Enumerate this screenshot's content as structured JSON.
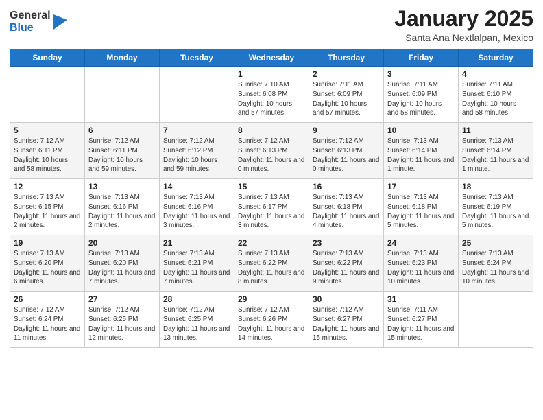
{
  "logo": {
    "general": "General",
    "blue": "Blue"
  },
  "header": {
    "month": "January 2025",
    "location": "Santa Ana Nextlalpan, Mexico"
  },
  "days_of_week": [
    "Sunday",
    "Monday",
    "Tuesday",
    "Wednesday",
    "Thursday",
    "Friday",
    "Saturday"
  ],
  "weeks": [
    [
      {
        "day": "",
        "info": ""
      },
      {
        "day": "",
        "info": ""
      },
      {
        "day": "",
        "info": ""
      },
      {
        "day": "1",
        "info": "Sunrise: 7:10 AM\nSunset: 6:08 PM\nDaylight: 10 hours and 57 minutes."
      },
      {
        "day": "2",
        "info": "Sunrise: 7:11 AM\nSunset: 6:09 PM\nDaylight: 10 hours and 57 minutes."
      },
      {
        "day": "3",
        "info": "Sunrise: 7:11 AM\nSunset: 6:09 PM\nDaylight: 10 hours and 58 minutes."
      },
      {
        "day": "4",
        "info": "Sunrise: 7:11 AM\nSunset: 6:10 PM\nDaylight: 10 hours and 58 minutes."
      }
    ],
    [
      {
        "day": "5",
        "info": "Sunrise: 7:12 AM\nSunset: 6:11 PM\nDaylight: 10 hours and 58 minutes."
      },
      {
        "day": "6",
        "info": "Sunrise: 7:12 AM\nSunset: 6:11 PM\nDaylight: 10 hours and 59 minutes."
      },
      {
        "day": "7",
        "info": "Sunrise: 7:12 AM\nSunset: 6:12 PM\nDaylight: 10 hours and 59 minutes."
      },
      {
        "day": "8",
        "info": "Sunrise: 7:12 AM\nSunset: 6:13 PM\nDaylight: 11 hours and 0 minutes."
      },
      {
        "day": "9",
        "info": "Sunrise: 7:12 AM\nSunset: 6:13 PM\nDaylight: 11 hours and 0 minutes."
      },
      {
        "day": "10",
        "info": "Sunrise: 7:13 AM\nSunset: 6:14 PM\nDaylight: 11 hours and 1 minute."
      },
      {
        "day": "11",
        "info": "Sunrise: 7:13 AM\nSunset: 6:14 PM\nDaylight: 11 hours and 1 minute."
      }
    ],
    [
      {
        "day": "12",
        "info": "Sunrise: 7:13 AM\nSunset: 6:15 PM\nDaylight: 11 hours and 2 minutes."
      },
      {
        "day": "13",
        "info": "Sunrise: 7:13 AM\nSunset: 6:16 PM\nDaylight: 11 hours and 2 minutes."
      },
      {
        "day": "14",
        "info": "Sunrise: 7:13 AM\nSunset: 6:16 PM\nDaylight: 11 hours and 3 minutes."
      },
      {
        "day": "15",
        "info": "Sunrise: 7:13 AM\nSunset: 6:17 PM\nDaylight: 11 hours and 3 minutes."
      },
      {
        "day": "16",
        "info": "Sunrise: 7:13 AM\nSunset: 6:18 PM\nDaylight: 11 hours and 4 minutes."
      },
      {
        "day": "17",
        "info": "Sunrise: 7:13 AM\nSunset: 6:18 PM\nDaylight: 11 hours and 5 minutes."
      },
      {
        "day": "18",
        "info": "Sunrise: 7:13 AM\nSunset: 6:19 PM\nDaylight: 11 hours and 5 minutes."
      }
    ],
    [
      {
        "day": "19",
        "info": "Sunrise: 7:13 AM\nSunset: 6:20 PM\nDaylight: 11 hours and 6 minutes."
      },
      {
        "day": "20",
        "info": "Sunrise: 7:13 AM\nSunset: 6:20 PM\nDaylight: 11 hours and 7 minutes."
      },
      {
        "day": "21",
        "info": "Sunrise: 7:13 AM\nSunset: 6:21 PM\nDaylight: 11 hours and 7 minutes."
      },
      {
        "day": "22",
        "info": "Sunrise: 7:13 AM\nSunset: 6:22 PM\nDaylight: 11 hours and 8 minutes."
      },
      {
        "day": "23",
        "info": "Sunrise: 7:13 AM\nSunset: 6:22 PM\nDaylight: 11 hours and 9 minutes."
      },
      {
        "day": "24",
        "info": "Sunrise: 7:13 AM\nSunset: 6:23 PM\nDaylight: 11 hours and 10 minutes."
      },
      {
        "day": "25",
        "info": "Sunrise: 7:13 AM\nSunset: 6:24 PM\nDaylight: 11 hours and 10 minutes."
      }
    ],
    [
      {
        "day": "26",
        "info": "Sunrise: 7:12 AM\nSunset: 6:24 PM\nDaylight: 11 hours and 11 minutes."
      },
      {
        "day": "27",
        "info": "Sunrise: 7:12 AM\nSunset: 6:25 PM\nDaylight: 11 hours and 12 minutes."
      },
      {
        "day": "28",
        "info": "Sunrise: 7:12 AM\nSunset: 6:25 PM\nDaylight: 11 hours and 13 minutes."
      },
      {
        "day": "29",
        "info": "Sunrise: 7:12 AM\nSunset: 6:26 PM\nDaylight: 11 hours and 14 minutes."
      },
      {
        "day": "30",
        "info": "Sunrise: 7:12 AM\nSunset: 6:27 PM\nDaylight: 11 hours and 15 minutes."
      },
      {
        "day": "31",
        "info": "Sunrise: 7:11 AM\nSunset: 6:27 PM\nDaylight: 11 hours and 15 minutes."
      },
      {
        "day": "",
        "info": ""
      }
    ]
  ]
}
